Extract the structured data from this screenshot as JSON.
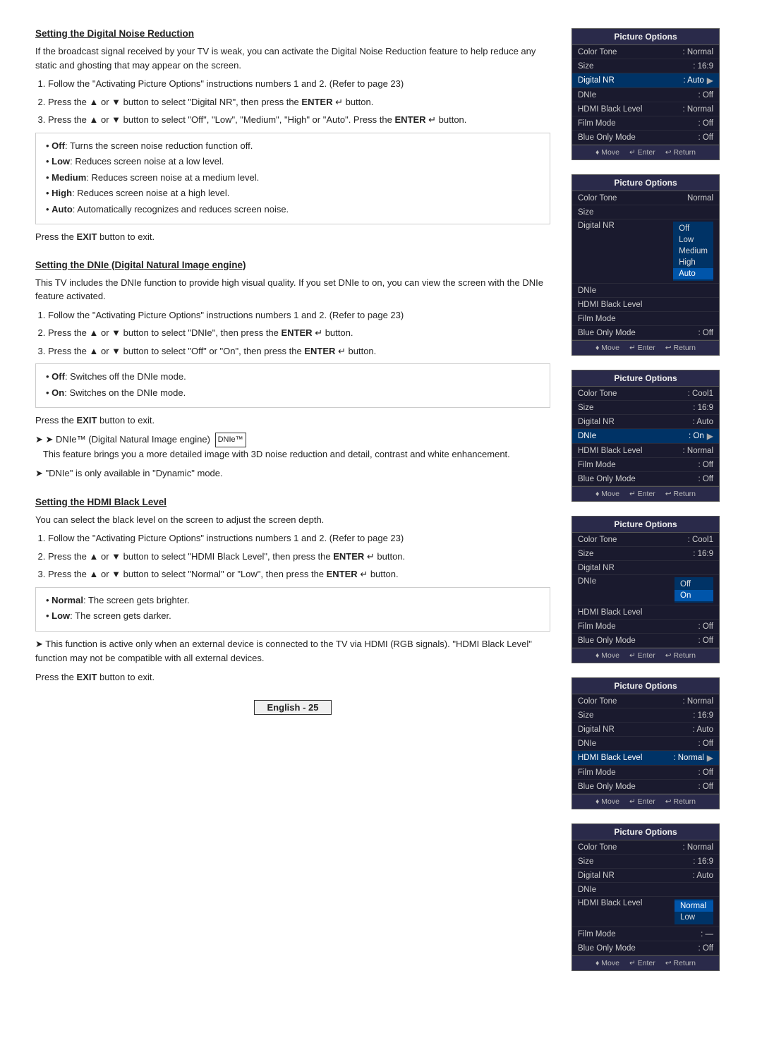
{
  "sections": [
    {
      "id": "digital-noise-reduction",
      "heading": "Setting the Digital Noise Reduction",
      "intro": "If the broadcast signal received by your TV is weak, you can activate the Digital Noise Reduction feature to help reduce any static and ghosting that may appear on the screen.",
      "steps": [
        "Follow the \"Activating Picture Options\" instructions numbers 1 and 2. (Refer to page 23)",
        "Press the ▲ or ▼ button to select \"Digital NR\", then press the ENTER  button.",
        "Press the ▲ or ▼ button to select \"Off\", \"Low\", \"Medium\", \"High\" or \"Auto\". Press the ENTER  button."
      ],
      "bullets": [
        {
          "bold": "Off",
          "text": ": Turns the screen noise reduction function off."
        },
        {
          "bold": "Low",
          "text": ": Reduces screen noise at a low level."
        },
        {
          "bold": "Medium",
          "text": ": Reduces screen noise at a medium level."
        },
        {
          "bold": "High",
          "text": ": Reduces screen noise at a high level."
        },
        {
          "bold": "Auto",
          "text": ": Automatically recognizes and reduces screen noise."
        }
      ],
      "press_exit": "Press the EXIT button to exit."
    },
    {
      "id": "dnie",
      "heading": "Setting the DNIe (Digital Natural Image engine)",
      "intro": "This TV includes the DNIe function to provide high visual quality. If you set DNIe to on, you can view the screen with the DNIe feature activated.",
      "steps": [
        "Follow the \"Activating Picture Options\" instructions numbers 1 and 2. (Refer to page 23)",
        "Press the ▲ or ▼ button to select \"DNIe\", then press the ENTER  button.",
        "Press the ▲ or ▼ button to select \"Off\" or \"On\", then press the ENTER  button."
      ],
      "bullets": [
        {
          "bold": "Off",
          "text": ": Switches off the DNIe mode."
        },
        {
          "bold": "On",
          "text": ": Switches on the DNIe mode."
        }
      ],
      "press_exit": "Press the EXIT button to exit.",
      "notes": [
        "DNIe™ (Digital Natural Image engine)  This feature brings you a more detailed image with 3D noise reduction and detail, contrast and white enhancement.",
        "\"DNIe\" is only available in \"Dynamic\" mode."
      ]
    },
    {
      "id": "hdmi-black-level",
      "heading": "Setting the HDMI Black Level",
      "intro": "You can select the black level on the screen to adjust the screen depth.",
      "steps": [
        "Follow the \"Activating Picture Options\" instructions numbers 1 and 2. (Refer to page 23)",
        "Press the ▲ or ▼ button to select \"HDMI Black Level\", then press the ENTER  button.",
        "Press the ▲ or ▼ button to select \"Normal\" or \"Low\", then press the ENTER  button."
      ],
      "bullets": [
        {
          "bold": "Normal",
          "text": ": The screen gets brighter."
        },
        {
          "bold": "Low",
          "text": ": The screen gets darker."
        }
      ],
      "press_exit": "Press the EXIT button to exit.",
      "notes": [
        "This function is active only when an external device is connected to the TV via HDMI (RGB signals). \"HDMI Black Level\" function may not be compatible with all external devices."
      ]
    }
  ],
  "panels": [
    {
      "id": "panel-1",
      "title": "Picture Options",
      "rows": [
        {
          "label": "Color Tone",
          "value": ": Normal",
          "highlighted": false
        },
        {
          "label": "Size",
          "value": ": 16:9",
          "highlighted": false
        },
        {
          "label": "Digital NR",
          "value": ": Auto",
          "highlighted": true,
          "arrow": true
        },
        {
          "label": "DNIe",
          "value": ": Off",
          "highlighted": false
        },
        {
          "label": "HDMI Black Level",
          "value": ": Normal",
          "highlighted": false
        },
        {
          "label": "Film Mode",
          "value": ": Off",
          "highlighted": false
        },
        {
          "label": "Blue Only Mode",
          "value": ": Off",
          "highlighted": false
        }
      ],
      "footer": [
        "♦ Move",
        "↵ Enter",
        "↩ Return"
      ]
    },
    {
      "id": "panel-2",
      "title": "Picture Options",
      "rows": [
        {
          "label": "Color Tone",
          "value": "Normal",
          "highlighted": false
        },
        {
          "label": "Size",
          "value": "",
          "highlighted": false
        },
        {
          "label": "Digital NR",
          "value": "",
          "highlighted": false,
          "dropdown": [
            "Off",
            "Low",
            "Medium",
            "High",
            "Auto"
          ],
          "selected": "Auto"
        },
        {
          "label": "DNIe",
          "value": "",
          "highlighted": false
        },
        {
          "label": "HDMI Black Level",
          "value": "",
          "highlighted": false
        },
        {
          "label": "Film Mode",
          "value": "",
          "highlighted": false
        },
        {
          "label": "Blue Only Mode",
          "value": ": Off",
          "highlighted": false
        }
      ],
      "footer": [
        "♦ Move",
        "↵ Enter",
        "↩ Return"
      ]
    },
    {
      "id": "panel-3",
      "title": "Picture Options",
      "rows": [
        {
          "label": "Color Tone",
          "value": ": Cool1",
          "highlighted": false
        },
        {
          "label": "Size",
          "value": ": 16:9",
          "highlighted": false
        },
        {
          "label": "Digital NR",
          "value": ": Auto",
          "highlighted": false
        },
        {
          "label": "DNIe",
          "value": ": On",
          "highlighted": true,
          "arrow": true
        },
        {
          "label": "HDMI Black Level",
          "value": ": Normal",
          "highlighted": false
        },
        {
          "label": "Film Mode",
          "value": ": Off",
          "highlighted": false
        },
        {
          "label": "Blue Only Mode",
          "value": ": Off",
          "highlighted": false
        }
      ],
      "footer": [
        "♦ Move",
        "↵ Enter",
        "↩ Return"
      ]
    },
    {
      "id": "panel-4",
      "title": "Picture Options",
      "rows": [
        {
          "label": "Color Tone",
          "value": ": Cool1",
          "highlighted": false
        },
        {
          "label": "Size",
          "value": ": 16:9",
          "highlighted": false
        },
        {
          "label": "Digital NR",
          "value": "",
          "highlighted": false
        },
        {
          "label": "DNIe",
          "value": "",
          "highlighted": false,
          "dropdown": [
            "Off",
            "On"
          ],
          "selected": "On"
        },
        {
          "label": "HDMI Black Level",
          "value": "",
          "highlighted": false
        },
        {
          "label": "Film Mode",
          "value": ": Off",
          "highlighted": false
        },
        {
          "label": "Blue Only Mode",
          "value": ": Off",
          "highlighted": false
        }
      ],
      "footer": [
        "♦ Move",
        "↵ Enter",
        "↩ Return"
      ]
    },
    {
      "id": "panel-5",
      "title": "Picture Options",
      "rows": [
        {
          "label": "Color Tone",
          "value": ": Normal",
          "highlighted": false
        },
        {
          "label": "Size",
          "value": ": 16:9",
          "highlighted": false
        },
        {
          "label": "Digital NR",
          "value": ": Auto",
          "highlighted": false
        },
        {
          "label": "DNIe",
          "value": ": Off",
          "highlighted": false
        },
        {
          "label": "HDMI Black Level",
          "value": ": Normal",
          "highlighted": true,
          "arrow": true
        },
        {
          "label": "Film Mode",
          "value": ": Off",
          "highlighted": false
        },
        {
          "label": "Blue Only Mode",
          "value": ": Off",
          "highlighted": false
        }
      ],
      "footer": [
        "♦ Move",
        "↵ Enter",
        "↩ Return"
      ]
    },
    {
      "id": "panel-6",
      "title": "Picture Options",
      "rows": [
        {
          "label": "Color Tone",
          "value": ": Normal",
          "highlighted": false
        },
        {
          "label": "Size",
          "value": ": 16:9",
          "highlighted": false
        },
        {
          "label": "Digital NR",
          "value": ": Auto",
          "highlighted": false
        },
        {
          "label": "DNIe",
          "value": "",
          "highlighted": false
        },
        {
          "label": "HDMI Black Level",
          "value": "",
          "highlighted": false,
          "dropdown": [
            "Normal",
            "Low"
          ],
          "selected": "Normal"
        },
        {
          "label": "Film Mode",
          "value": ": —",
          "highlighted": false
        },
        {
          "label": "Blue Only Mode",
          "value": ": Off",
          "highlighted": false
        }
      ],
      "footer": [
        "♦ Move",
        "↵ Enter",
        "↩ Return"
      ]
    }
  ],
  "page_number": "English - 25",
  "enter_symbol": "↵",
  "dnle_badge_text": "DNIe™"
}
